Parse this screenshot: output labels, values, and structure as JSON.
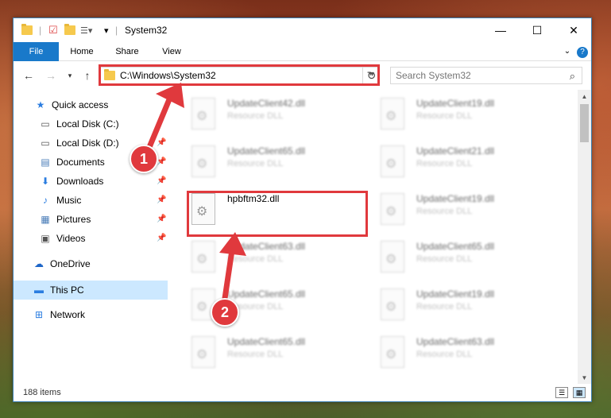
{
  "title": "System32",
  "ribbon_tabs": [
    "File",
    "Home",
    "Share",
    "View"
  ],
  "address": {
    "path": "C:\\Windows\\System32"
  },
  "search": {
    "placeholder": "Search System32"
  },
  "nav": {
    "items": [
      {
        "label": "Quick access",
        "icon": "star-icon"
      },
      {
        "label": "Local Disk (C:)",
        "icon": "drive-icon"
      },
      {
        "label": "Local Disk (D:)",
        "icon": "drive-icon"
      },
      {
        "label": "Documents",
        "icon": "documents-icon"
      },
      {
        "label": "Downloads",
        "icon": "download-icon"
      },
      {
        "label": "Music",
        "icon": "music-icon"
      },
      {
        "label": "Pictures",
        "icon": "pictures-icon"
      },
      {
        "label": "Videos",
        "icon": "videos-icon"
      },
      {
        "label": "OneDrive",
        "icon": "cloud-icon"
      },
      {
        "label": "This PC",
        "icon": "computer-icon"
      },
      {
        "label": "Network",
        "icon": "network-icon"
      }
    ]
  },
  "files": {
    "col1": [
      {
        "name": "UpdateClient42.dll",
        "type": "Resource DLL"
      },
      {
        "name": "UpdateClient65.dll",
        "type": "Resource DLL"
      },
      {
        "name": "hpbftm32.dll",
        "type": ""
      },
      {
        "name": "UpdateClient63.dll",
        "type": "Resource DLL"
      },
      {
        "name": "UpdateClient65.dll",
        "type": "Resource DLL"
      },
      {
        "name": "UpdateClient65.dll",
        "type": "Resource DLL"
      }
    ],
    "col2": [
      {
        "name": "UpdateClient19.dll",
        "type": "Resource DLL"
      },
      {
        "name": "UpdateClient21.dll",
        "type": "Resource DLL"
      },
      {
        "name": "UpdateClient19.dll",
        "type": "Resource DLL"
      },
      {
        "name": "UpdateClient65.dll",
        "type": "Resource DLL"
      },
      {
        "name": "UpdateClient19.dll",
        "type": "Resource DLL"
      },
      {
        "name": "UpdateClient63.dll",
        "type": "Resource DLL"
      }
    ]
  },
  "status": {
    "items": "188 items"
  },
  "callouts": [
    "1",
    "2"
  ],
  "colors": {
    "accent": "#1979ca",
    "highlight": "#e0393d",
    "selection": "#cce8ff"
  }
}
